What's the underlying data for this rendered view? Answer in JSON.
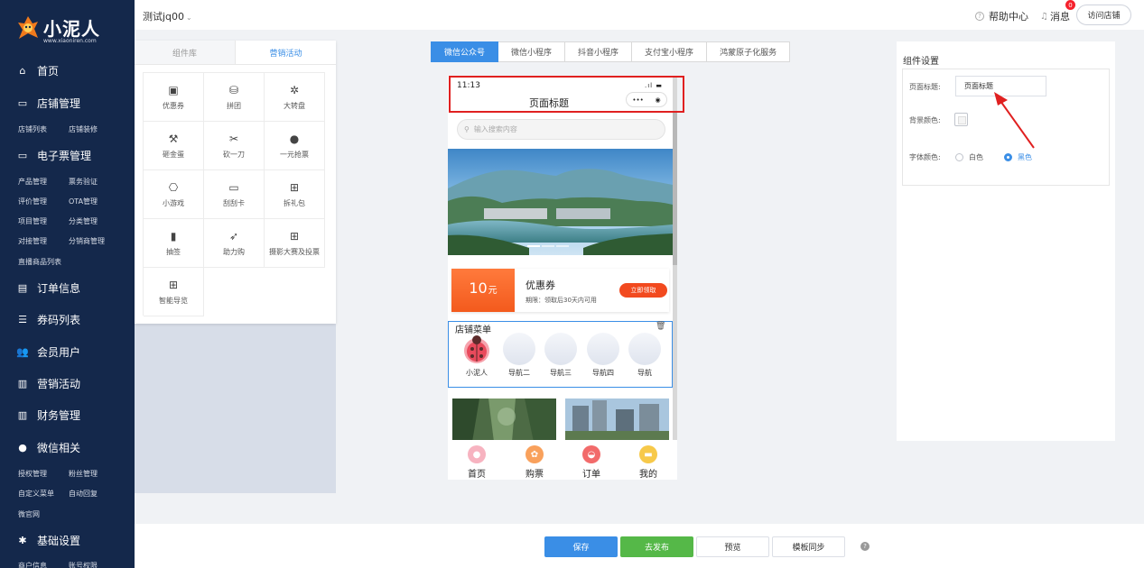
{
  "brand": {
    "name": "小泥人",
    "url": "www.xiaoniren.com"
  },
  "header": {
    "store_name": "测试jq00",
    "help": "帮助中心",
    "messages": "消息",
    "message_count": "0",
    "visit_store": "访问店铺"
  },
  "sidebar": {
    "home": "首页",
    "store_manage": "店铺管理",
    "store_subs": [
      "店铺列表",
      "店铺装修"
    ],
    "eticket_manage": "电子票管理",
    "eticket_subs": [
      [
        "产品管理",
        "票务验证"
      ],
      [
        "评价管理",
        "OTA管理"
      ],
      [
        "项目管理",
        "分类管理"
      ],
      [
        "对接管理",
        "分销商管理"
      ],
      [
        "直播商品列表"
      ]
    ],
    "orders": "订单信息",
    "codes": "券码列表",
    "members": "会员用户",
    "marketing": "营销活动",
    "finance": "财务管理",
    "wechat": "微信相关",
    "wechat_subs": [
      [
        "授权管理",
        "粉丝管理"
      ],
      [
        "自定义菜单",
        "自动回复"
      ],
      [
        "微官网"
      ]
    ],
    "basic": "基础设置",
    "basic_subs": [
      "商户信息",
      "账号权限"
    ]
  },
  "components": {
    "tabs": [
      "组件库",
      "营销活动"
    ],
    "active_tab": 1,
    "items": [
      {
        "label": "优惠券",
        "icon": "ticket-icon"
      },
      {
        "label": "拼团",
        "icon": "bag-icon"
      },
      {
        "label": "大转盘",
        "icon": "wheel-icon"
      },
      {
        "label": "砸金蛋",
        "icon": "hammer-icon"
      },
      {
        "label": "砍一刀",
        "icon": "scissors-icon"
      },
      {
        "label": "一元抢票",
        "icon": "coin-icon"
      },
      {
        "label": "小游戏",
        "icon": "gamepad-icon"
      },
      {
        "label": "刮刮卡",
        "icon": "card-icon"
      },
      {
        "label": "拆礼包",
        "icon": "gift-icon"
      },
      {
        "label": "抽签",
        "icon": "lot-icon"
      },
      {
        "label": "助力购",
        "icon": "rocket-icon"
      },
      {
        "label": "摄影大赛及投票",
        "icon": "gift-icon"
      },
      {
        "label": "智能导览",
        "icon": "gift-icon"
      }
    ]
  },
  "platforms": [
    "微信公众号",
    "微信小程序",
    "抖音小程序",
    "支付宝小程序",
    "鸿蒙原子化服务"
  ],
  "phone": {
    "time": "11:13",
    "page_title": "页面标题",
    "search_placeholder": "输入搜索内容",
    "coupon": {
      "amount": "10",
      "unit": "元",
      "name": "优惠券",
      "term": "期限：领取后30天内可用",
      "button": "立即领取"
    },
    "menu": {
      "title": "店铺菜单",
      "items": [
        "小泥人",
        "导航二",
        "导航三",
        "导航四",
        "导航"
      ]
    },
    "tabbar": [
      "首页",
      "购票",
      "订单",
      "我的"
    ]
  },
  "settings": {
    "title": "组件设置",
    "page_title_label": "页面标题:",
    "page_title_value": "页面标题",
    "bg_color_label": "背景颜色:",
    "font_color_label": "字体颜色:",
    "font_options": [
      "白色",
      "黑色"
    ],
    "selected_font": "黑色"
  },
  "footer": {
    "save": "保存",
    "publish": "去发布",
    "preview": "预览",
    "sync": "模板同步",
    "help": "?"
  },
  "colors": {
    "primary": "#3a8ee6",
    "sidebar": "#14284b",
    "publish": "#55b848",
    "highlight": "#e02020"
  }
}
